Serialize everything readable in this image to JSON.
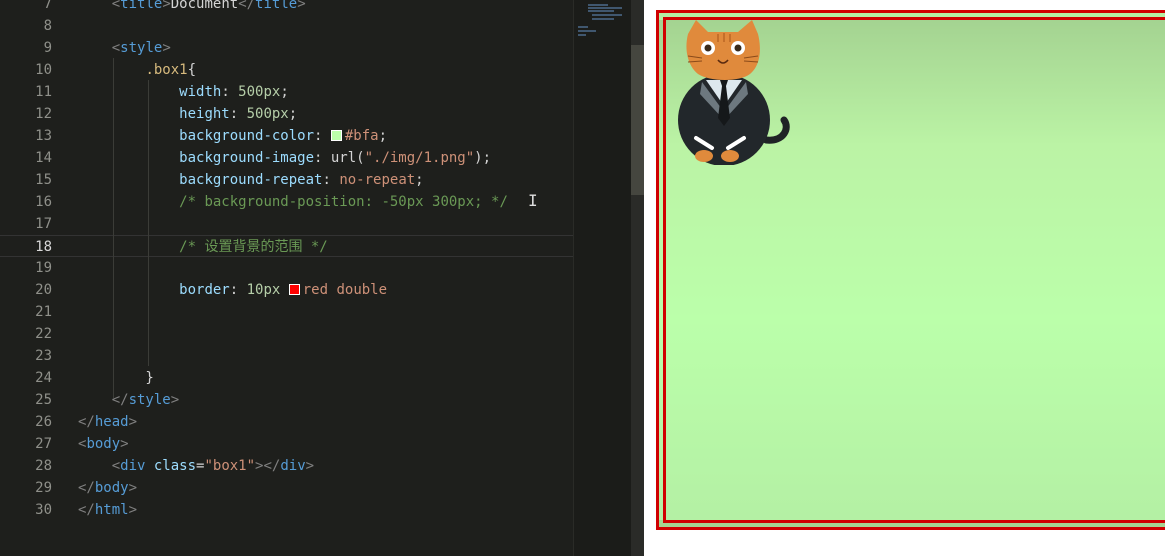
{
  "editor": {
    "lines": [
      {
        "n": "7",
        "tokens": [
          [
            "punc",
            "    <"
          ],
          [
            "tag",
            "title"
          ],
          [
            "punc",
            ">"
          ],
          [
            "txt",
            "Document"
          ],
          [
            "punc",
            "</"
          ],
          [
            "tag",
            "title"
          ],
          [
            "punc",
            ">"
          ]
        ]
      },
      {
        "n": "8",
        "tokens": []
      },
      {
        "n": "9",
        "tokens": [
          [
            "punc",
            "    <"
          ],
          [
            "tag",
            "style"
          ],
          [
            "punc",
            ">"
          ]
        ]
      },
      {
        "n": "10",
        "tokens": [
          [
            "plain",
            "        "
          ],
          [
            "sel",
            ".box1"
          ],
          [
            "plain",
            "{"
          ]
        ]
      },
      {
        "n": "11",
        "tokens": [
          [
            "plain",
            "            "
          ],
          [
            "prop",
            "width"
          ],
          [
            "plain",
            ": "
          ],
          [
            "num",
            "500px"
          ],
          [
            "plain",
            ";"
          ]
        ]
      },
      {
        "n": "12",
        "tokens": [
          [
            "plain",
            "            "
          ],
          [
            "prop",
            "height"
          ],
          [
            "plain",
            ": "
          ],
          [
            "num",
            "500px"
          ],
          [
            "plain",
            ";"
          ]
        ]
      },
      {
        "n": "13",
        "tokens": [
          [
            "plain",
            "            "
          ],
          [
            "prop",
            "background-color"
          ],
          [
            "plain",
            ": "
          ],
          [
            "swatch",
            "#bbffaa"
          ],
          [
            "val",
            "#bfa"
          ],
          [
            "plain",
            ";"
          ]
        ]
      },
      {
        "n": "14",
        "tokens": [
          [
            "plain",
            "            "
          ],
          [
            "prop",
            "background-image"
          ],
          [
            "plain",
            ": "
          ],
          [
            "plain",
            "url("
          ],
          [
            "str",
            "\"./img/1.png\""
          ],
          [
            "plain",
            ");"
          ]
        ]
      },
      {
        "n": "15",
        "tokens": [
          [
            "plain",
            "            "
          ],
          [
            "prop",
            "background-repeat"
          ],
          [
            "plain",
            ": "
          ],
          [
            "val",
            "no-repeat"
          ],
          [
            "plain",
            ";"
          ]
        ]
      },
      {
        "n": "16",
        "tokens": [
          [
            "plain",
            "            "
          ],
          [
            "cmt",
            "/* background-position: -50px 300px; */"
          ]
        ]
      },
      {
        "n": "17",
        "tokens": []
      },
      {
        "n": "18",
        "tokens": [
          [
            "plain",
            "            "
          ],
          [
            "cmt",
            "/* 设置背景的范围 */"
          ]
        ]
      },
      {
        "n": "19",
        "tokens": []
      },
      {
        "n": "20",
        "tokens": [
          [
            "plain",
            "            "
          ],
          [
            "prop",
            "border"
          ],
          [
            "plain",
            ": "
          ],
          [
            "num",
            "10px "
          ],
          [
            "swatch",
            "#ff0000"
          ],
          [
            "val",
            "red double"
          ]
        ]
      },
      {
        "n": "21",
        "tokens": []
      },
      {
        "n": "22",
        "tokens": []
      },
      {
        "n": "23",
        "tokens": []
      },
      {
        "n": "24",
        "tokens": [
          [
            "plain",
            "        }"
          ]
        ]
      },
      {
        "n": "25",
        "tokens": [
          [
            "punc",
            "    </"
          ],
          [
            "tag",
            "style"
          ],
          [
            "punc",
            ">"
          ]
        ]
      },
      {
        "n": "26",
        "tokens": [
          [
            "punc",
            "</"
          ],
          [
            "tag",
            "head"
          ],
          [
            "punc",
            ">"
          ]
        ]
      },
      {
        "n": "27",
        "tokens": [
          [
            "punc",
            "<"
          ],
          [
            "tag",
            "body"
          ],
          [
            "punc",
            ">"
          ]
        ]
      },
      {
        "n": "28",
        "tokens": [
          [
            "punc",
            "    <"
          ],
          [
            "tag",
            "div "
          ],
          [
            "attr",
            "class"
          ],
          [
            "plain",
            "="
          ],
          [
            "str",
            "\"box1\""
          ],
          [
            "punc",
            "></"
          ],
          [
            "tag",
            "div"
          ],
          [
            "punc",
            ">"
          ]
        ]
      },
      {
        "n": "29",
        "tokens": [
          [
            "punc",
            "</"
          ],
          [
            "tag",
            "body"
          ],
          [
            "punc",
            ">"
          ]
        ]
      },
      {
        "n": "30",
        "tokens": [
          [
            "punc",
            "</"
          ],
          [
            "tag",
            "html"
          ],
          [
            "punc",
            ">"
          ]
        ]
      }
    ],
    "current_line": "18"
  },
  "preview": {
    "box_background": "#bbffaa",
    "border_color": "#ff0000"
  },
  "icons": {
    "cat": "cat-illustration",
    "cursor": "text-cursor-icon"
  }
}
